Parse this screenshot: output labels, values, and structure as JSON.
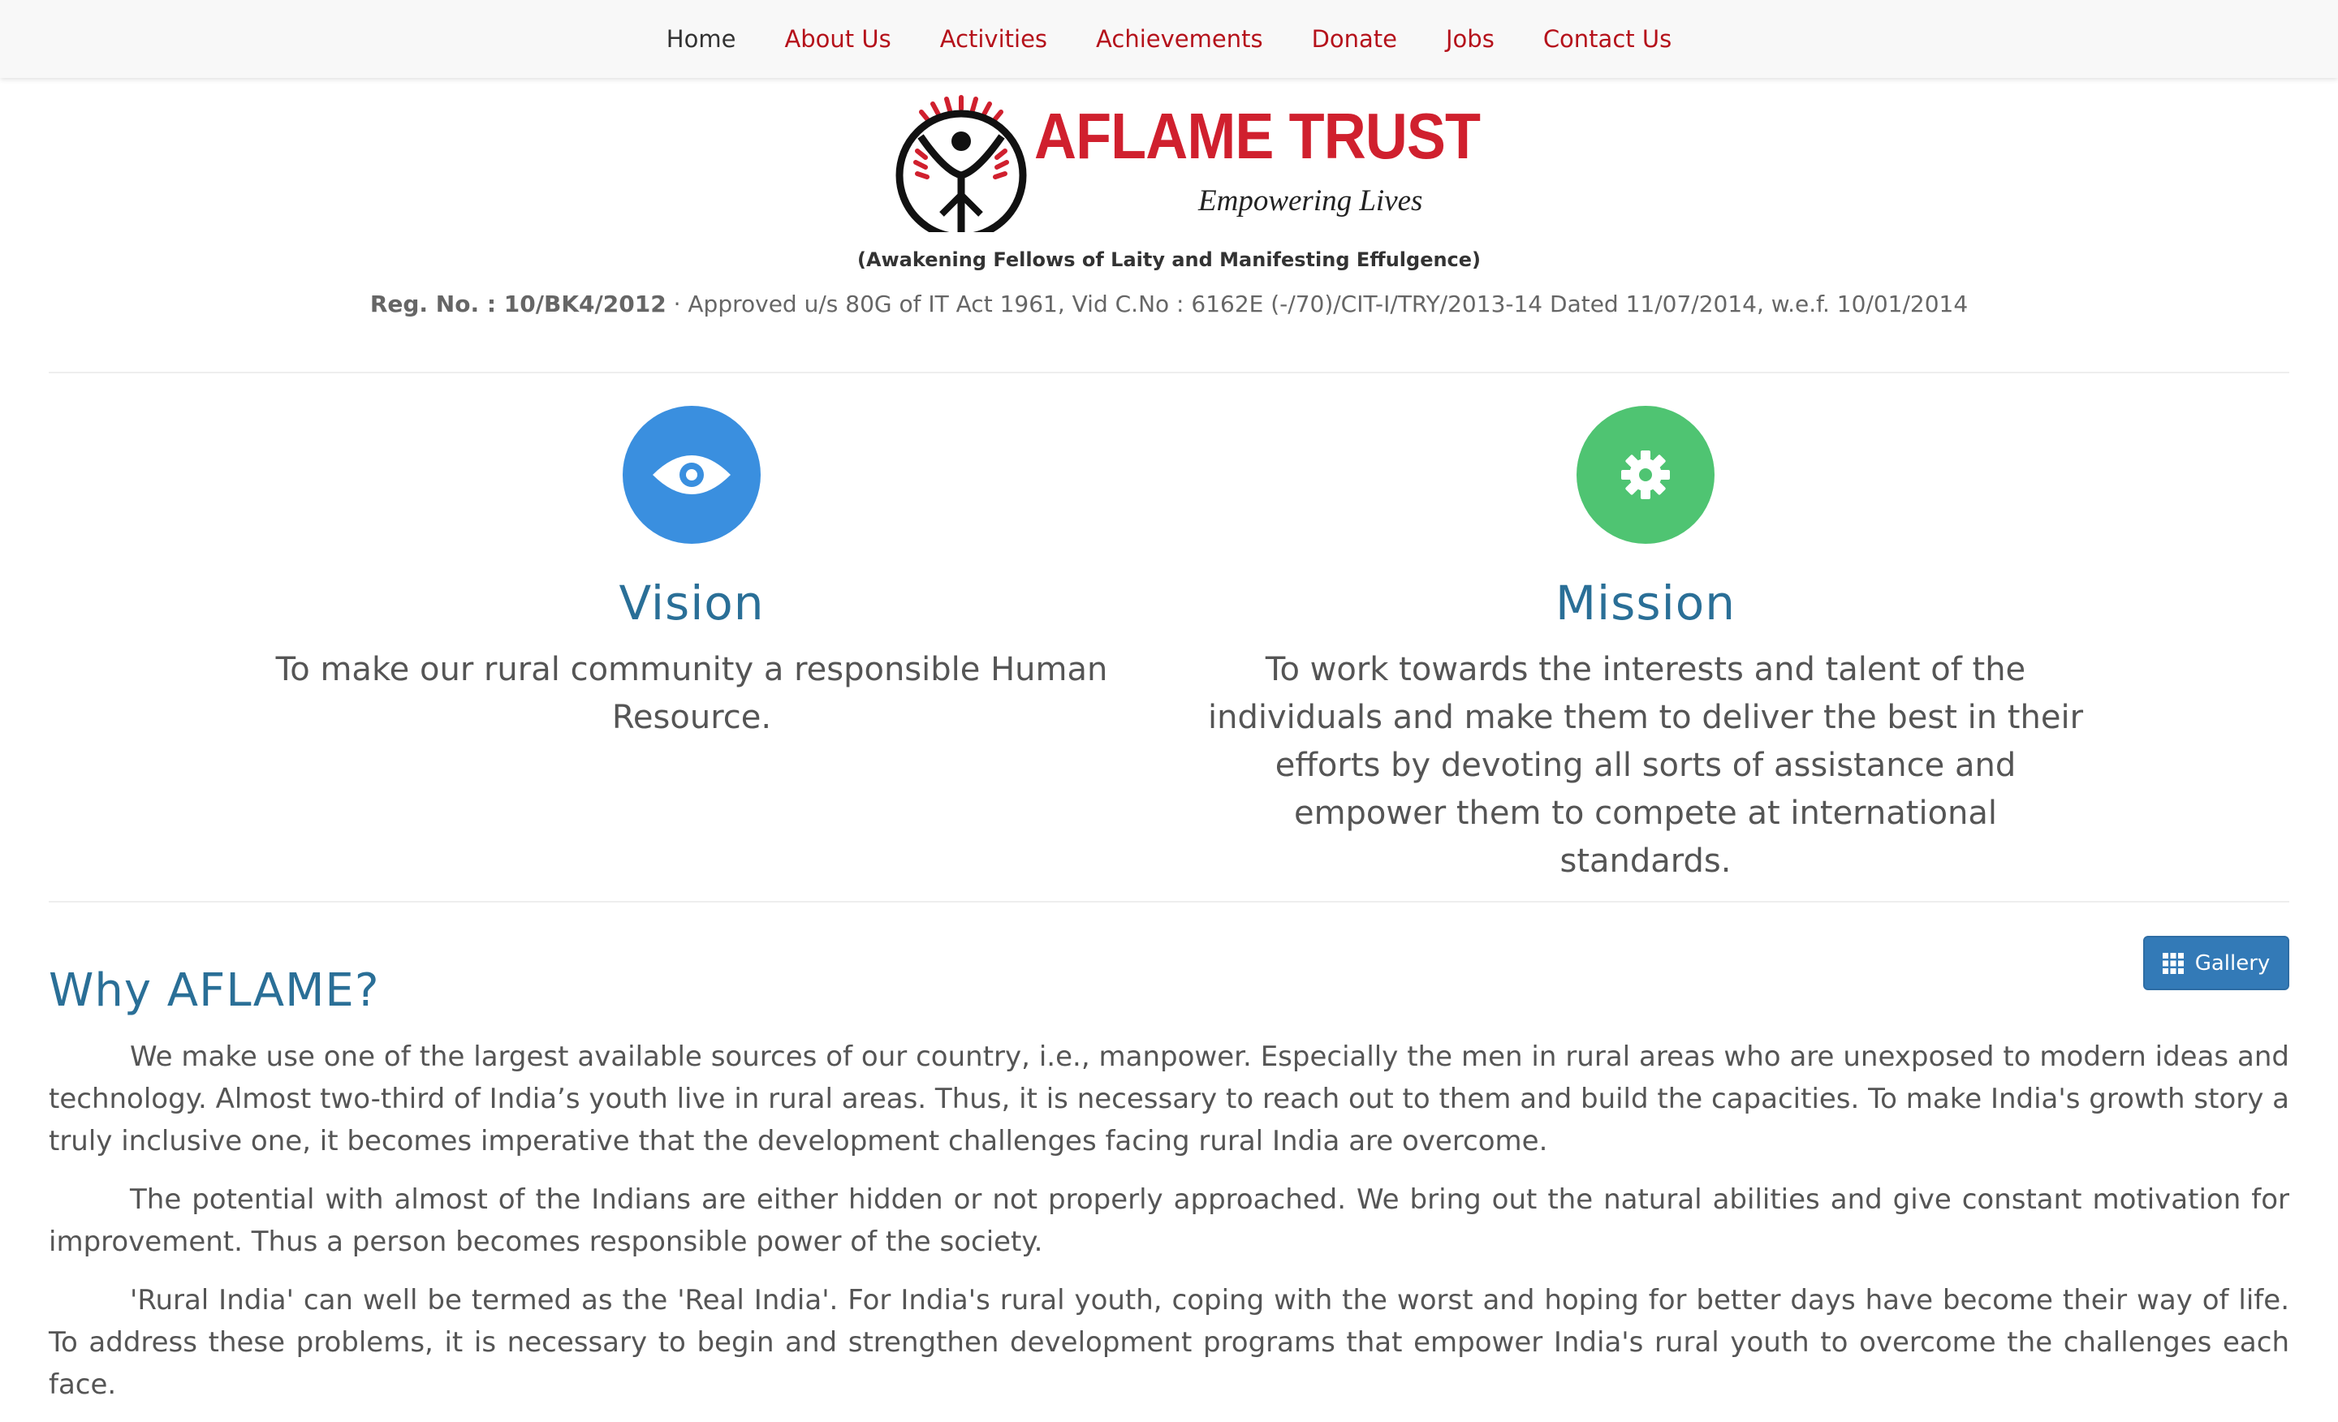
{
  "nav": {
    "items": [
      {
        "label": "Home",
        "active": true
      },
      {
        "label": "About Us",
        "active": false
      },
      {
        "label": "Activities",
        "active": false
      },
      {
        "label": "Achievements",
        "active": false
      },
      {
        "label": "Donate",
        "active": false
      },
      {
        "label": "Jobs",
        "active": false
      },
      {
        "label": "Contact Us",
        "active": false
      }
    ]
  },
  "header": {
    "logo_title": "AFLAME TRUST",
    "logo_tagline": "Empowering Lives",
    "subtitle": "(Awakening Fellows of Laity and Manifesting Effulgence)",
    "reg_label": "Reg. No. : 10/BK4/2012",
    "reg_detail": " · Approved u/s 80G of IT Act 1961, Vid C.No : 6162E (-/70)/CIT-I/TRY/2013-14 Dated 11/07/2014, w.e.f. 10/01/2014"
  },
  "vision": {
    "icon": "eye-icon",
    "title": "Vision",
    "text": "To make our rural community a responsible Human Resource."
  },
  "mission": {
    "icon": "gear-icon",
    "title": "Mission",
    "text": "To work towards the interests and talent of the individuals and make them to deliver the best in their efforts by devoting all sorts of assistance and empower them to compete at international standards."
  },
  "why": {
    "title": "Why AFLAME?",
    "gallery_label": "Gallery",
    "paragraphs": [
      "We make use one of the largest available sources of our country, i.e., manpower. Especially the men in rural areas who are unexposed to modern ideas and technology. Almost two-third of India’s youth live in rural areas. Thus, it is necessary to reach out to them and build the capacities. To make India's growth story a truly inclusive one, it becomes imperative that the development challenges facing rural India are overcome.",
      "The potential with almost of the Indians are either hidden or not properly approached. We bring out the natural abilities and give constant motivation for improvement. Thus a person becomes responsible power of the society.",
      "'Rural India' can well be termed as the 'Real India'. For India's rural youth, coping with the worst and hoping for better days have become their way of life. To address these problems, it is necessary to begin and strengthen development programs that empower India's rural youth to overcome the challenges each face."
    ]
  },
  "colors": {
    "nav_link": "#b5121b",
    "heading": "#2a6f97",
    "vision_circle": "#3a8fdf",
    "mission_circle": "#4fc472",
    "logo_red": "#d0202e",
    "button": "#337ab7"
  }
}
